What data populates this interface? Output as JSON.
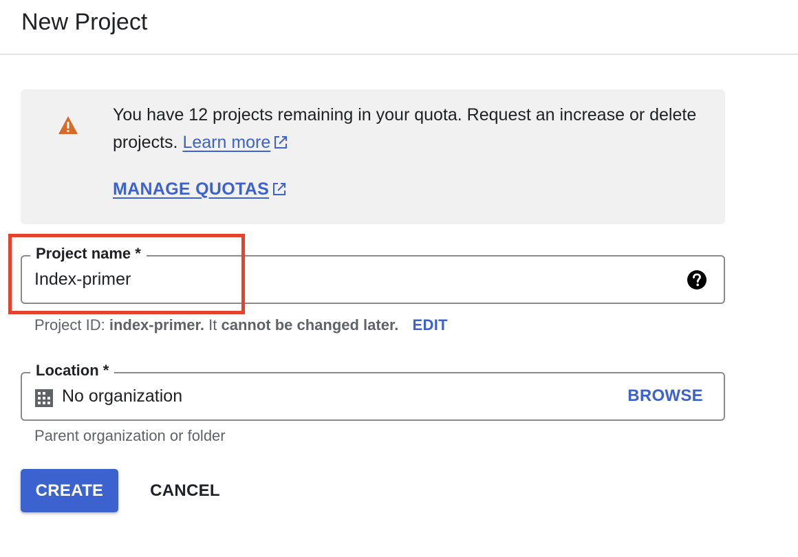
{
  "header": {
    "title": "New Project"
  },
  "quota_banner": {
    "icon": "warning-icon",
    "message": "You have 12 projects remaining in your quota. Request an increase or delete projects.",
    "learn_more_label": "Learn more",
    "manage_quotas_label": "MANAGE QUOTAS",
    "warning_color": "#d86a2a"
  },
  "project_name_field": {
    "label": "Project name *",
    "value": "Index-primer",
    "help_icon": "help-icon"
  },
  "project_id_helper": {
    "prefix": "Project ID:",
    "project_id": "index-primer.",
    "middle": "It",
    "emphasis": "cannot be changed later.",
    "edit_label": "EDIT"
  },
  "location_field": {
    "label": "Location *",
    "icon": "building-icon",
    "value": "No organization",
    "browse_label": "BROWSE",
    "hint": "Parent organization or folder"
  },
  "actions": {
    "create_label": "CREATE",
    "cancel_label": "CANCEL"
  },
  "colors": {
    "accent": "#3b62cf",
    "highlight": "#e6412b",
    "banner_bg": "#f1f1f1"
  }
}
